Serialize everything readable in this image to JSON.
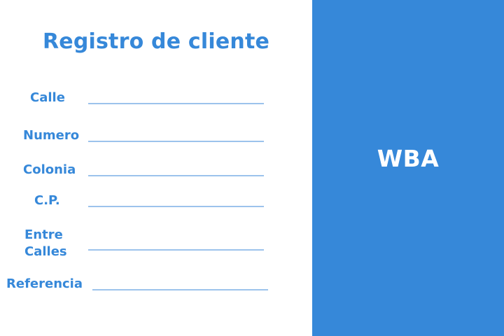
{
  "form": {
    "title": "Registro de cliente",
    "fields": [
      {
        "label": "Calle",
        "value": ""
      },
      {
        "label": "Numero",
        "value": ""
      },
      {
        "label": "Colonia",
        "value": ""
      },
      {
        "label": "C.P.",
        "value": ""
      },
      {
        "label_line1": "Entre",
        "label_line2": "Calles",
        "value": ""
      },
      {
        "label": "Referencia",
        "value": ""
      }
    ]
  },
  "brand": {
    "name": "WBA"
  },
  "colors": {
    "accent": "#3688d9",
    "underline": "#9cc3ec",
    "background": "#ffffff",
    "brand_text": "#ffffff"
  }
}
